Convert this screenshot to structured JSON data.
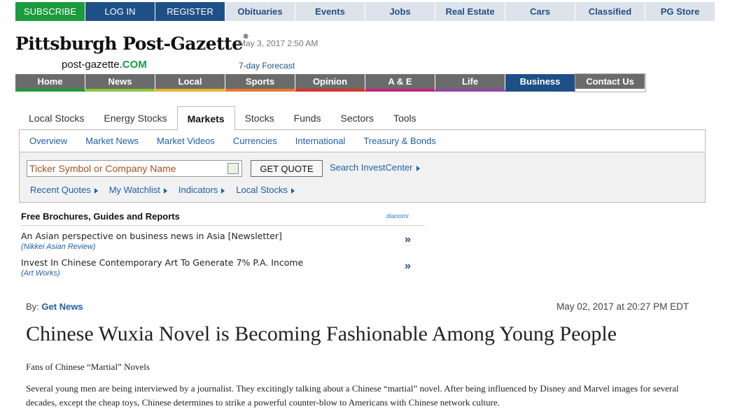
{
  "topbar": {
    "subscribe": "SUBSCRIBE",
    "login": "LOG IN",
    "register": "REGISTER",
    "links": [
      "Obituaries",
      "Events",
      "Jobs",
      "Real Estate",
      "Cars",
      "Classified",
      "PG Store"
    ]
  },
  "header": {
    "masthead": "Pittsburgh Post-Gazette",
    "registered": "®",
    "site_prefix": "post-gazette.",
    "site_suffix": "COM",
    "date": "May 3, 2017 2:50 AM",
    "forecast": "7-day Forecast"
  },
  "mainnav": [
    "Home",
    "News",
    "Local",
    "Sports",
    "Opinion",
    "A & E",
    "Life",
    "Business",
    "Contact Us"
  ],
  "invest": {
    "tabs": [
      "Local Stocks",
      "Energy Stocks",
      "Markets",
      "Stocks",
      "Funds",
      "Sectors",
      "Tools"
    ],
    "active_tab": "Markets",
    "subnav": [
      "Overview",
      "Market News",
      "Market Videos",
      "Currencies",
      "International",
      "Treasury & Bonds"
    ],
    "ticker_placeholder": "Ticker Symbol or Company Name",
    "get_quote": "GET QUOTE",
    "search_link": "Search InvestCenter",
    "quicklinks": [
      "Recent Quotes",
      "My Watchlist",
      "Indicators",
      "Local Stocks"
    ]
  },
  "brochures": {
    "title": "Free Brochures, Guides and Reports",
    "brand": "dianomi",
    "items": [
      {
        "title": "An Asian perspective on business news in Asia [Newsletter]",
        "source": "(Nikkei Asian Review)",
        "go": "»"
      },
      {
        "title": "Invest In Chinese Contemporary Art To Generate 7% P.A. Income",
        "source": "(Art Works)",
        "go": "»"
      }
    ]
  },
  "article": {
    "by_label": "By:",
    "author": "Get News",
    "date": "May 02, 2017 at 20:27 PM EDT",
    "headline": "Chinese Wuxia Novel is Becoming Fashionable Among Young People",
    "subhead": "Fans of Chinese “Martial” Novels",
    "paragraph": "Several young men are being interviewed by a journalist. They excitingly talking about a Chinese “martial” novel. After being influenced by Disney and Marvel images for several decades, except the cheap toys, Chinese determines to strike a powerful counter-blow to Americans with Chinese network culture."
  },
  "colors": {
    "subscribe_green": "#1a9b3c",
    "brand_blue": "#1f4f87",
    "link_blue": "#1f5fa8",
    "nav_gray": "#6b6b6b"
  }
}
